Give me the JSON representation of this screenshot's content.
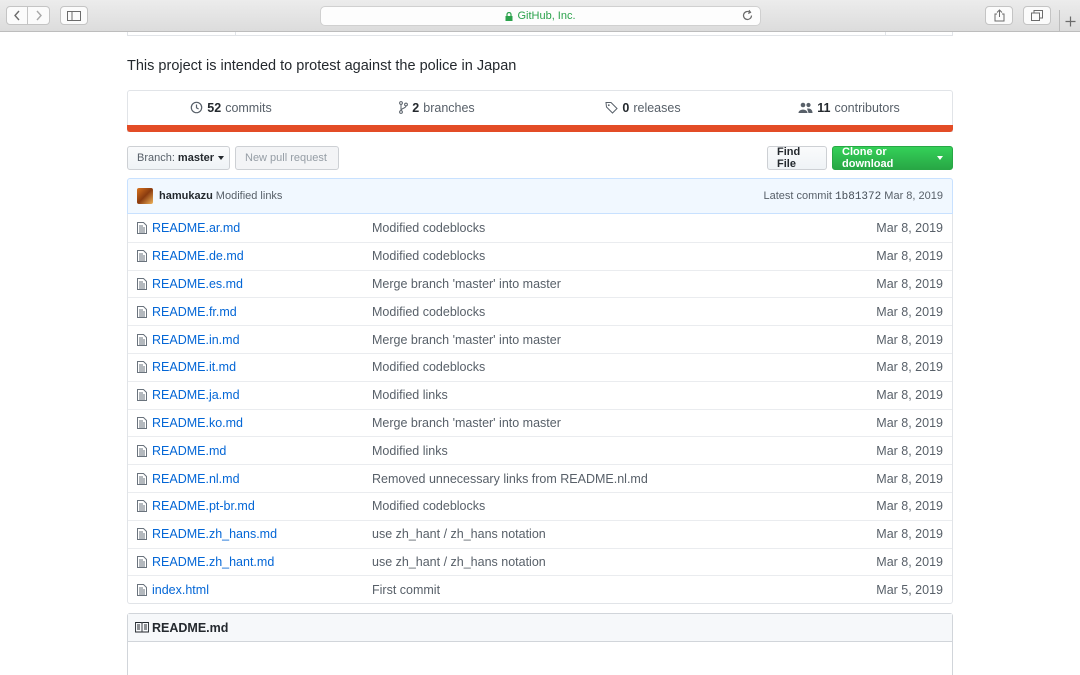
{
  "browser": {
    "url_text": "GitHub, Inc."
  },
  "repo": {
    "description": "This project is intended to protest against the police in Japan",
    "summary": {
      "commits": {
        "count": "52",
        "label": "commits"
      },
      "branches": {
        "count": "2",
        "label": "branches"
      },
      "releases": {
        "count": "0",
        "label": "releases"
      },
      "contributors": {
        "count": "11",
        "label": "contributors"
      }
    },
    "language_color": "#e34c26"
  },
  "toolbar": {
    "branch_label": "Branch:",
    "branch_value": "master",
    "new_pr_label": "New pull request",
    "find_file_label": "Find File",
    "clone_label": "Clone or download"
  },
  "latest_commit": {
    "author": "hamukazu",
    "message": "Modified links",
    "prefix": "Latest commit",
    "sha": "1b81372",
    "date": "Mar 8, 2019"
  },
  "files": [
    {
      "name": "README.ar.md",
      "message": "Modified codeblocks",
      "date": "Mar 8, 2019"
    },
    {
      "name": "README.de.md",
      "message": "Modified codeblocks",
      "date": "Mar 8, 2019"
    },
    {
      "name": "README.es.md",
      "message": "Merge branch 'master' into master",
      "date": "Mar 8, 2019"
    },
    {
      "name": "README.fr.md",
      "message": "Modified codeblocks",
      "date": "Mar 8, 2019"
    },
    {
      "name": "README.in.md",
      "message": "Merge branch 'master' into master",
      "date": "Mar 8, 2019"
    },
    {
      "name": "README.it.md",
      "message": "Modified codeblocks",
      "date": "Mar 8, 2019"
    },
    {
      "name": "README.ja.md",
      "message": "Modified links",
      "date": "Mar 8, 2019"
    },
    {
      "name": "README.ko.md",
      "message": "Merge branch 'master' into master",
      "date": "Mar 8, 2019"
    },
    {
      "name": "README.md",
      "message": "Modified links",
      "date": "Mar 8, 2019"
    },
    {
      "name": "README.nl.md",
      "message": "Removed unnecessary links from README.nl.md",
      "date": "Mar 8, 2019"
    },
    {
      "name": "README.pt-br.md",
      "message": "Modified codeblocks",
      "date": "Mar 8, 2019"
    },
    {
      "name": "README.zh_hans.md",
      "message": "use zh_hant / zh_hans notation",
      "date": "Mar 8, 2019"
    },
    {
      "name": "README.zh_hant.md",
      "message": "use zh_hant / zh_hans notation",
      "date": "Mar 8, 2019"
    },
    {
      "name": "index.html",
      "message": "First commit",
      "date": "Mar 5, 2019"
    }
  ],
  "readme": {
    "title": "README.md"
  }
}
